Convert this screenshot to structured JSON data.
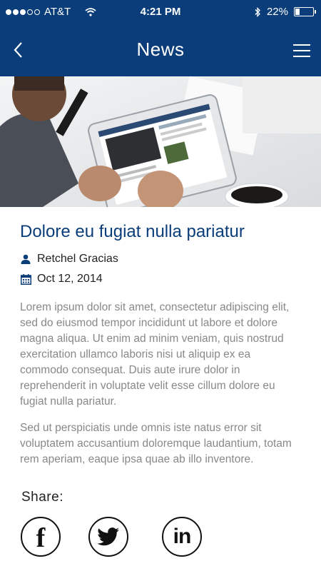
{
  "status_bar": {
    "carrier": "AT&T",
    "time": "4:21 PM",
    "battery_percent": "22%",
    "battery_level": 0.22,
    "signal_icon": "signal-dots-icon",
    "wifi_icon": "wifi-icon",
    "bluetooth_icon": "bluetooth-icon"
  },
  "nav": {
    "title": "News",
    "back_icon": "chevron-left-icon",
    "menu_icon": "hamburger-menu-icon"
  },
  "article": {
    "title": "Dolore eu fugiat nulla pariatur",
    "author": "Retchel Gracias",
    "date": "Oct 12, 2014",
    "paragraphs": [
      "Lorem ipsum dolor sit amet, consectetur adipiscing elit, sed do eiusmod tempor incididunt ut labore et dolore magna aliqua. Ut enim ad minim veniam, quis nostrud exercitation ullamco laboris nisi ut aliquip ex ea commodo consequat. Duis aute irure dolor in reprehenderit in voluptate velit esse cillum dolore eu fugiat nulla pariatur.",
      "Sed ut perspiciatis unde omnis iste natus error sit voluptatem accusantium doloremque laudantium, totam rem aperiam, eaque ipsa quae ab illo inventore."
    ]
  },
  "share": {
    "label": "Share:",
    "buttons": [
      {
        "icon": "facebook-icon"
      },
      {
        "icon": "twitter-icon"
      },
      {
        "icon": "linkedin-icon"
      }
    ]
  },
  "colors": {
    "brand": "#0a3d7a",
    "body_text": "#888888"
  }
}
